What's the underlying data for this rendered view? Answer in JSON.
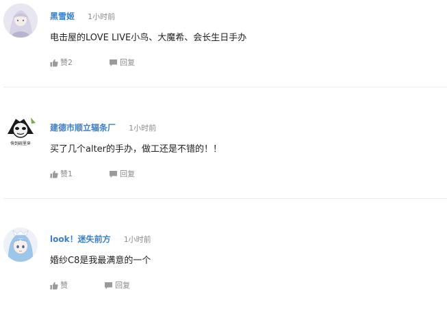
{
  "comments": [
    {
      "username": "黑雪姬",
      "time": "1小时前",
      "content": "电击屋的LOVE LIVE小鸟、大魔希、会长生日手办",
      "like_label": "赞2",
      "reply_label": "回复",
      "avatar_icon": "anime-girl-avatar"
    },
    {
      "username": "建德市顺立辐条厂",
      "time": "1小时前",
      "content": "买了几个alter的手办，做工还是不错的！！",
      "like_label": "赞1",
      "reply_label": "回复",
      "avatar_icon": "panda-meme-avatar",
      "avatar_caption": "快到碗里来"
    },
    {
      "username": "look！迷失前方",
      "time": "1小时前",
      "content": "婚纱C8是我最满意的一个",
      "like_label": "赞",
      "reply_label": "回复",
      "avatar_icon": "blue-hair-maid-avatar"
    }
  ],
  "icons": {
    "like": "thumbs-up-icon",
    "reply": "speech-bubble-icon"
  },
  "colors": {
    "username": "#3a7fc7",
    "meta": "#8a8a8a",
    "text": "#222222",
    "divider": "#ececec"
  }
}
